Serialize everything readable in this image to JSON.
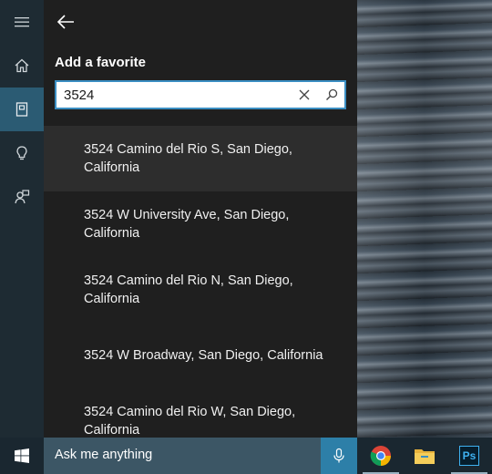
{
  "panel": {
    "title": "Add a favorite"
  },
  "search": {
    "value": "3524"
  },
  "results": [
    {
      "text": "3524 Camino del Rio S, San Diego, California"
    },
    {
      "text": "3524 W University Ave, San Diego, California"
    },
    {
      "text": "3524 Camino del Rio N, San Diego, California"
    },
    {
      "text": "3524 W Broadway, San Diego, California"
    },
    {
      "text": "3524 Camino del Rio W, San Diego, California"
    }
  ],
  "taskbar": {
    "ask_text": "Ask me anything",
    "photoshop_label": "Ps"
  },
  "icons": {
    "rail": [
      "hamburger-menu-icon",
      "home-icon",
      "notebook-icon",
      "lightbulb-icon",
      "feedback-icon"
    ],
    "panel": [
      "back-arrow-icon",
      "clear-icon",
      "search-icon"
    ],
    "taskbar": [
      "windows-logo-icon",
      "microphone-icon",
      "chrome-icon",
      "file-explorer-icon",
      "photoshop-icon"
    ]
  },
  "colors": {
    "rail_bg": "#1e2b33",
    "rail_active": "#2b5b73",
    "panel_bg": "#1f1f1f",
    "highlight_row": "#2d2d2d",
    "search_border": "#3b8ec2",
    "taskbar_bg": "#1a2730",
    "ask_box_bg": "#3c5665",
    "mic_bg": "#2d7fa8"
  }
}
